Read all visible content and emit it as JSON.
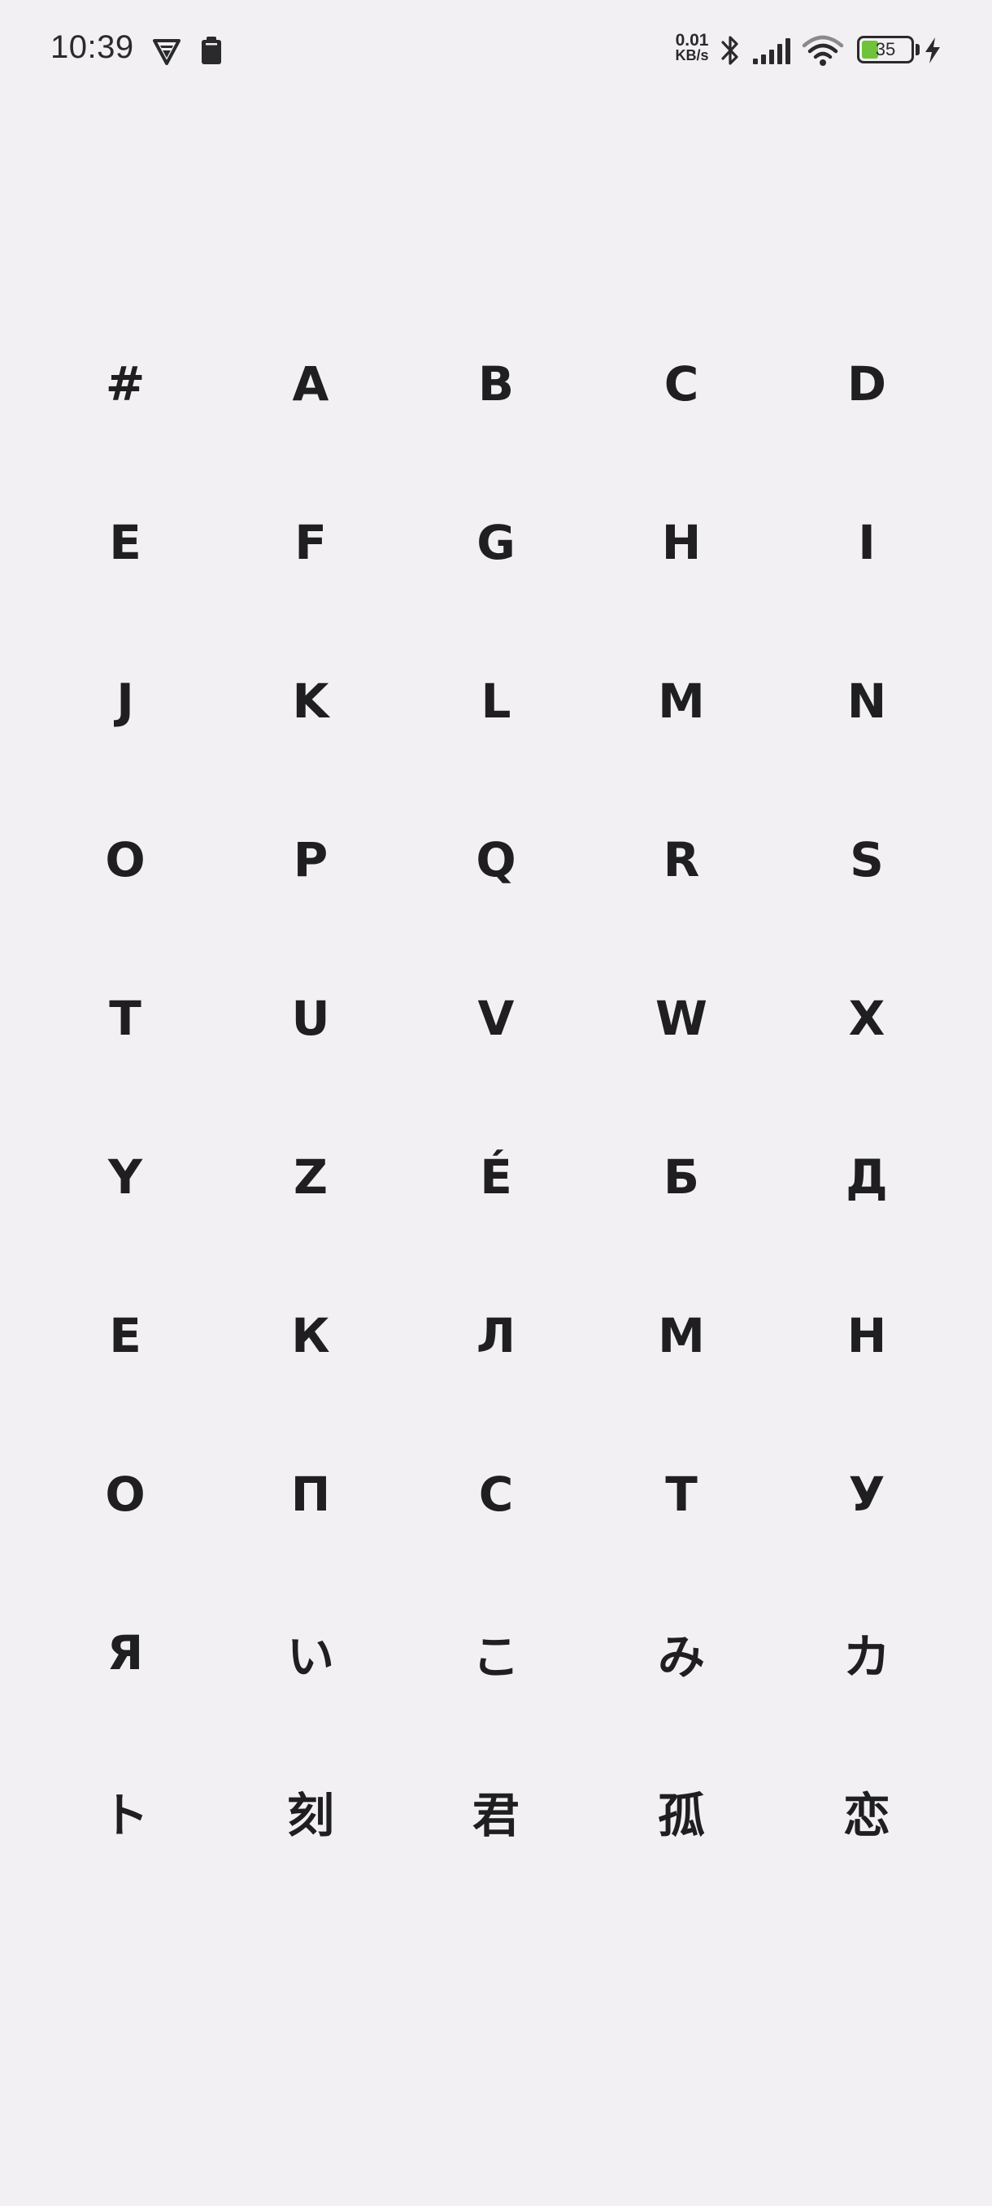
{
  "status_bar": {
    "time": "10:39",
    "net_speed_value": "0.01",
    "net_speed_unit": "KB/s",
    "battery_level": "35",
    "battery_fraction": 0.35,
    "battery_color": "#6fc23a",
    "icons": [
      "vpn-icon",
      "clipboard-icon",
      "bluetooth-icon",
      "signal-icon",
      "wifi-icon",
      "battery-icon",
      "charging-bolt-icon"
    ]
  },
  "index_letters": [
    "#",
    "A",
    "B",
    "C",
    "D",
    "E",
    "F",
    "G",
    "H",
    "I",
    "J",
    "K",
    "L",
    "M",
    "N",
    "O",
    "P",
    "Q",
    "R",
    "S",
    "T",
    "U",
    "V",
    "W",
    "X",
    "Y",
    "Z",
    "É",
    "Б",
    "Д",
    "Е",
    "К",
    "Л",
    "М",
    "Н",
    "О",
    "П",
    "С",
    "Т",
    "У",
    "Я",
    "い",
    "こ",
    "み",
    "カ",
    "ト",
    "刻",
    "君",
    "孤",
    "恋"
  ]
}
